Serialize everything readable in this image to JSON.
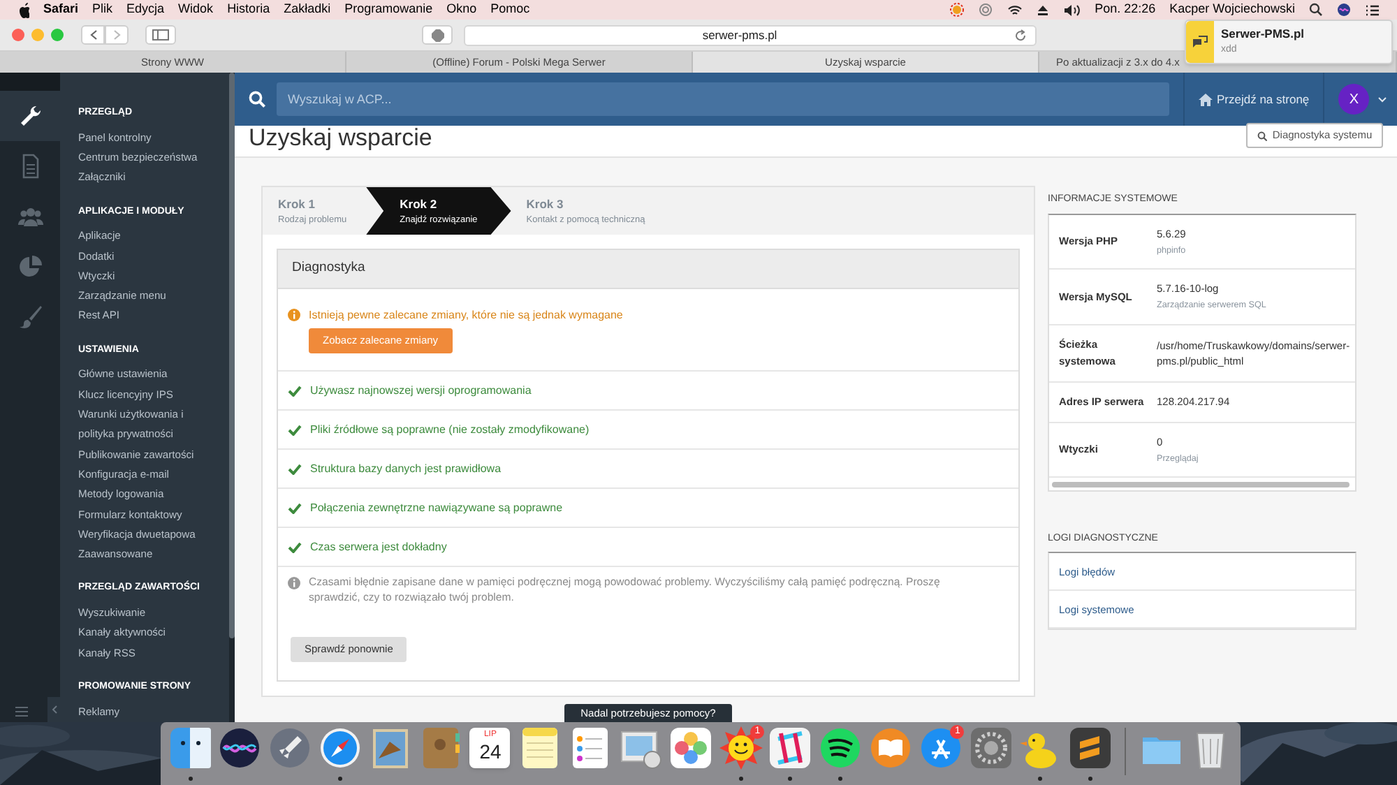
{
  "menu_bar": {
    "app": "Safari",
    "items": [
      "Plik",
      "Edycja",
      "Widok",
      "Historia",
      "Zakładki",
      "Programowanie",
      "Okno",
      "Pomoc"
    ],
    "clock": "Pon. 22:26",
    "user": "Kacper Wojciechowski"
  },
  "browser": {
    "url": "serwer-pms.pl",
    "tabs": [
      {
        "label": "Strony WWW",
        "selected": false
      },
      {
        "label": "(Offline) Forum - Polski Mega Serwer",
        "selected": false
      },
      {
        "label": "Uzyskaj wsparcie",
        "selected": true
      },
      {
        "label": "Po aktualizacji z 3.x do 4.x",
        "selected": false
      }
    ]
  },
  "notification": {
    "title": "Serwer-PMS.pl",
    "body": "xdd"
  },
  "sidebar": {
    "icon_rail": [
      {
        "kind": "wrench",
        "selected": true
      },
      {
        "kind": "document",
        "selected": false
      },
      {
        "kind": "users",
        "selected": false
      },
      {
        "kind": "pie",
        "selected": false
      },
      {
        "kind": "brush",
        "selected": false
      }
    ],
    "sections": [
      {
        "title": "PRZEGLĄD",
        "items": [
          "Panel kontrolny",
          "Centrum bezpieczeństwa",
          "Załączniki"
        ]
      },
      {
        "title": "APLIKACJE I MODUŁY",
        "items": [
          "Aplikacje",
          "Dodatki",
          "Wtyczki",
          "Zarządzanie menu",
          "Rest API"
        ]
      },
      {
        "title": "USTAWIENIA",
        "items": [
          "Główne ustawienia",
          "Klucz licencyjny IPS",
          "Warunki użytkowania i",
          "polityka prywatności",
          "Publikowanie zawartości",
          "Konfiguracja e-mail",
          "Metody logowania",
          "Formularz kontaktowy",
          "Weryfikacja dwuetapowa",
          "Zaawansowane"
        ]
      },
      {
        "title": "PRZEGLĄD ZAWARTOŚCI",
        "items": [
          "Wyszukiwanie",
          "Kanały aktywności",
          "Kanały RSS"
        ]
      },
      {
        "title": "PROMOWANIE STRONY",
        "items": [
          "Reklamy"
        ]
      }
    ]
  },
  "header": {
    "search": {
      "placeholder": "Wyszukaj w ACP..."
    },
    "site_link": "Przejdź na stronę",
    "avatar": "X"
  },
  "page": {
    "title": "Uzyskaj wsparcie",
    "action": "Diagnostyka systemu"
  },
  "steps": [
    {
      "title": "Krok 1",
      "subtitle": "Rodzaj problemu",
      "selected": false
    },
    {
      "title": "Krok 2",
      "subtitle": "Znajdź rozwiązanie",
      "selected": true
    },
    {
      "title": "Krok 3",
      "subtitle": "Kontakt z pomocą techniczną",
      "selected": false
    }
  ],
  "diagnostics": {
    "title": "Diagnostyka",
    "items": [
      {
        "kind": "warning",
        "text": "Istnieją pewne zalecane zmiany, które nie są jednak wymagane",
        "button": "Zobacz zalecane zmiany"
      },
      {
        "kind": "success",
        "text": "Używasz najnowszej wersji oprogramowania"
      },
      {
        "kind": "success",
        "text": "Pliki źródłowe są poprawne (nie zostały zmodyfikowane)"
      },
      {
        "kind": "success",
        "text": "Struktura bazy danych jest prawidłowa"
      },
      {
        "kind": "success",
        "text": "Połączenia zewnętrzne nawiązywane są poprawne"
      },
      {
        "kind": "success",
        "text": "Czas serwera jest dokładny"
      },
      {
        "kind": "info",
        "text": "Czasami błędnie zapisane dane w pamięci podręcznej mogą powodować problemy. Wyczyściliśmy całą pamięć podręczną. Proszę sprawdzić, czy to rozwiązało twój problem."
      }
    ],
    "button": "Sprawdź ponownie"
  },
  "help_button": "Nadal potrzebujesz pomocy?",
  "system_info": {
    "title": "INFORMACJE SYSTEMOWE",
    "rows": [
      {
        "label": "Wersja PHP",
        "value": "5.6.29",
        "link": "phpinfo"
      },
      {
        "label": "Wersja MySQL",
        "value": "5.7.16-10-log",
        "link": "Zarządzanie serwerem SQL"
      },
      {
        "label": "Ścieżka systemowa",
        "value": "/usr/home/Truskawkowy/domains/serwer-pms.pl/public_html"
      },
      {
        "label": "Adres IP serwera",
        "value": "128.204.217.94"
      },
      {
        "label": "Wtyczki",
        "value": "0",
        "link": "Przeglądaj"
      }
    ]
  },
  "logs": {
    "title": "LOGI DIAGNOSTYCZNE",
    "items": [
      "Logi błędów",
      "Logi systemowe"
    ]
  },
  "dock": {
    "apps": [
      {
        "kind": "finder",
        "running": true
      },
      {
        "kind": "siri",
        "running": false
      },
      {
        "kind": "rocket",
        "running": false
      },
      {
        "kind": "compass",
        "running": true
      },
      {
        "kind": "stamp",
        "running": false
      },
      {
        "kind": "contacts",
        "running": false
      },
      {
        "kind": "calendar",
        "running": false,
        "month": "LIP",
        "day": "24"
      },
      {
        "kind": "notes",
        "running": false
      },
      {
        "kind": "checklist",
        "running": false
      },
      {
        "kind": "viewer",
        "running": false
      },
      {
        "kind": "flower",
        "running": false
      },
      {
        "kind": "sun",
        "running": true,
        "badge": "1"
      },
      {
        "kind": "tile",
        "running": true
      },
      {
        "kind": "waves",
        "running": true
      },
      {
        "kind": "book",
        "running": false
      },
      {
        "kind": "appstore",
        "running": false,
        "badge": "1"
      },
      {
        "kind": "gear",
        "running": false
      },
      {
        "kind": "duck",
        "running": true
      },
      {
        "kind": "editor",
        "running": true
      },
      {
        "kind": "folder",
        "running": false
      },
      {
        "kind": "trash",
        "running": false
      }
    ]
  }
}
